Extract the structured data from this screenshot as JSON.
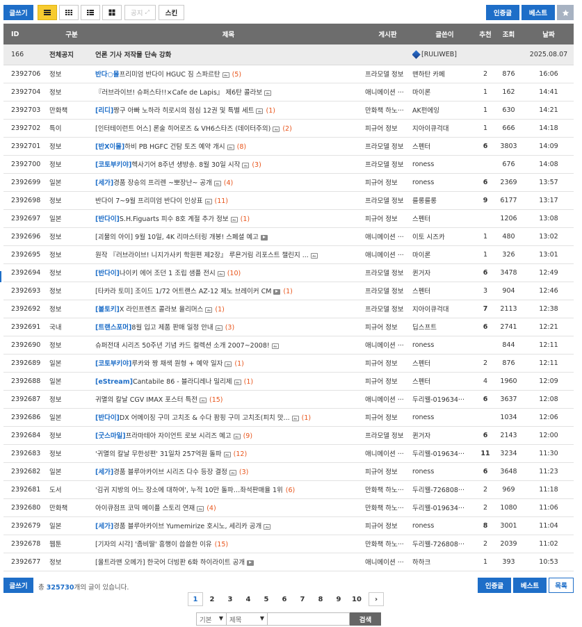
{
  "toolbar": {
    "write": "글쓰기",
    "notice": "공지",
    "skin": "스킨",
    "certified": "인증글",
    "best": "베스트"
  },
  "columns": {
    "id": "ID",
    "category": "구분",
    "title": "제목",
    "board": "게시판",
    "author": "글쓴이",
    "recommend": "추천",
    "views": "조회",
    "date": "날짜"
  },
  "notice_row": {
    "id": "166",
    "category": "전체공지",
    "title": "언론 기사 저작물 단속 강화",
    "author": "[RULIWEB]",
    "date": "2025.08.07"
  },
  "rows": [
    {
      "id": "2392706",
      "category": "정보",
      "tag": "반다○몰",
      "title": "프리미엄 반다이 HGUC 짐 스파르탄",
      "icon": "image",
      "comments": "(5)",
      "board": "프라모델 정보",
      "author": "맨하탄 카페",
      "recommend": "2",
      "rec_hot": false,
      "views": "876",
      "date": "16:06"
    },
    {
      "id": "2392704",
      "category": "정보",
      "tag": "",
      "title": "『러브라이브! 슈퍼스타!!×Cafe de Lapis』 제6탄 콜라보",
      "icon": "image",
      "comments": "",
      "board": "애니메이션 ···",
      "author": "마이론",
      "recommend": "1",
      "rec_hot": false,
      "views": "162",
      "date": "14:41"
    },
    {
      "id": "2392703",
      "category": "만화책",
      "tag": "[리디]",
      "title": "짱구 아빠 노하라 히로시의 점심 12권 및 특별 세트",
      "icon": "image",
      "comments": "(1)",
      "board": "만화책 하노···",
      "author": "AK펀에잉",
      "recommend": "1",
      "rec_hot": false,
      "views": "630",
      "date": "14:21"
    },
    {
      "id": "2392702",
      "category": "특이",
      "tag": "",
      "title": "[인터테이런트 어스] 론술 히어로즈 & VH6스타즈 (데이터주의)",
      "icon": "image",
      "comments": "(2)",
      "board": "피규어 정보",
      "author": "지아이큐걱대",
      "recommend": "1",
      "rec_hot": false,
      "views": "666",
      "date": "14:18"
    },
    {
      "id": "2392701",
      "category": "정보",
      "tag": "[반X이몰]",
      "title": "하비 PB HGFC 건탐 토즈 예약 개시",
      "icon": "image",
      "comments": "(8)",
      "board": "프라모델 정보",
      "author": "스펜터",
      "recommend": "6",
      "rec_hot": true,
      "views": "3803",
      "date": "14:09"
    },
    {
      "id": "2392700",
      "category": "정보",
      "tag": "[코토부키야]",
      "title": "헥사기어 8주년 생방송. 8월 30일 시작",
      "icon": "image",
      "comments": "(3)",
      "board": "프라모델 정보",
      "author": "roness",
      "recommend": "",
      "rec_hot": false,
      "views": "676",
      "date": "14:08"
    },
    {
      "id": "2392699",
      "category": "일본",
      "tag": "[세가]",
      "title": "경품 장승의 프리렌 ~뽀장난~ 공개",
      "icon": "image",
      "comments": "(4)",
      "board": "피규어 정보",
      "author": "roness",
      "recommend": "6",
      "rec_hot": true,
      "views": "2369",
      "date": "13:57"
    },
    {
      "id": "2392698",
      "category": "정보",
      "tag": "",
      "title": "반다이 7~9월 프리미엄 반다이 인상표",
      "icon": "image",
      "comments": "(11)",
      "board": "프라모델 정보",
      "author": "를롱를롱",
      "recommend": "9",
      "rec_hot": true,
      "views": "6177",
      "date": "13:17"
    },
    {
      "id": "2392697",
      "category": "일본",
      "tag": "[반다이]",
      "title": "S.H.Figuarts 피수 8호 계절 추가 정보",
      "icon": "image",
      "comments": "(1)",
      "board": "피규어 정보",
      "author": "스펜터",
      "recommend": "",
      "rec_hot": false,
      "views": "1206",
      "date": "13:08"
    },
    {
      "id": "2392696",
      "category": "정보",
      "tag": "",
      "title": "[괴물의 아이] 9월 10일, 4K 리마스터링 개봉! 스페셜 예고",
      "icon": "video",
      "comments": "",
      "board": "애니메이션 ···",
      "author": "이토 시즈카",
      "recommend": "1",
      "rec_hot": false,
      "views": "480",
      "date": "13:02"
    },
    {
      "id": "2392695",
      "category": "정보",
      "tag": "",
      "title": "원작 『러브라이브! 니지가사키 학원편 제2장』 루욘거림 리포스트 챌린지 ...",
      "icon": "image",
      "comments": "",
      "board": "애니메이션 ···",
      "author": "마이론",
      "recommend": "1",
      "rec_hot": false,
      "views": "326",
      "date": "13:01"
    },
    {
      "id": "2392694",
      "category": "정보",
      "tag": "[반다이]",
      "title": "나이키 에어 조던 1 조립 샘플 전시",
      "icon": "image",
      "comments": "(10)",
      "board": "프라모델 정보",
      "author": "퀸거자",
      "recommend": "6",
      "rec_hot": true,
      "views": "3478",
      "date": "12:49"
    },
    {
      "id": "2392693",
      "category": "정보",
      "tag": "",
      "title": "[타카라 토미] 조이드 1/72 어트랜스 AZ-12 제노 브레이커 CM",
      "icon": "video",
      "comments": "(1)",
      "board": "프라모델 정보",
      "author": "스펜터",
      "recommend": "3",
      "rec_hot": false,
      "views": "904",
      "date": "12:46"
    },
    {
      "id": "2392692",
      "category": "정보",
      "tag": "[볼토키]",
      "title": "X 라인프렌즈 콜라보 율리머스",
      "icon": "image",
      "comments": "(1)",
      "board": "프라모델 정보",
      "author": "지아이큐걱대",
      "recommend": "7",
      "rec_hot": true,
      "views": "2113",
      "date": "12:38"
    },
    {
      "id": "2392691",
      "category": "국내",
      "tag": "[트랜스포머]",
      "title": "8월 입고 제품 판매 일정 안내",
      "icon": "image",
      "comments": "(3)",
      "board": "피규어 정보",
      "author": "딥스프트",
      "recommend": "6",
      "rec_hot": true,
      "views": "2741",
      "date": "12:21"
    },
    {
      "id": "2392690",
      "category": "정보",
      "tag": "",
      "title": "슈퍼전대 시리즈 50주년 기념 카드 컬렉션 소개 2007~2008!",
      "icon": "image",
      "comments": "",
      "board": "애니메이션 ···",
      "author": "roness",
      "recommend": "",
      "rec_hot": false,
      "views": "844",
      "date": "12:11"
    },
    {
      "id": "2392689",
      "category": "일본",
      "tag": "[코토부키야]",
      "title": "루카와 짱 채색 원형 + 예약 일자",
      "icon": "image",
      "comments": "(1)",
      "board": "피규어 정보",
      "author": "스펜터",
      "recommend": "2",
      "rec_hot": false,
      "views": "876",
      "date": "12:11"
    },
    {
      "id": "2392688",
      "category": "일본",
      "tag": "[eStream]",
      "title": "Cantabile 86 - 블라디레나 밀리제",
      "icon": "image",
      "comments": "(1)",
      "board": "피규어 정보",
      "author": "스펜터",
      "recommend": "4",
      "rec_hot": false,
      "views": "1960",
      "date": "12:09"
    },
    {
      "id": "2392687",
      "category": "정보",
      "tag": "",
      "title": "귀멸의 칼날 CGV IMAX 포스터 특전",
      "icon": "image",
      "comments": "(15)",
      "board": "애니메이션 ···",
      "author": "두리웰-019634···",
      "recommend": "6",
      "rec_hot": true,
      "views": "3637",
      "date": "12:08"
    },
    {
      "id": "2392686",
      "category": "일본",
      "tag": "[반다이]",
      "title": "DX 어메이징 구미 고치조 & 수다 팜핑 구미 고치조(피치 맛...",
      "icon": "image",
      "comments": "(1)",
      "board": "피규어 정보",
      "author": "roness",
      "recommend": "",
      "rec_hot": false,
      "views": "1034",
      "date": "12:06"
    },
    {
      "id": "2392684",
      "category": "정보",
      "tag": "[굿스마일]",
      "title": "프라마테아 자이언트 로보 시리즈 예고",
      "icon": "image",
      "comments": "(9)",
      "board": "프라모델 정보",
      "author": "퀸거자",
      "recommend": "6",
      "rec_hot": true,
      "views": "2143",
      "date": "12:00"
    },
    {
      "id": "2392683",
      "category": "정보",
      "tag": "",
      "title": "'귀멸의 칼날 무한성편' 31일차 257억원 돌파",
      "icon": "image",
      "comments": "(12)",
      "board": "애니메이션 ···",
      "author": "두리웰-019634···",
      "recommend": "11",
      "rec_hot": true,
      "views": "3234",
      "date": "11:30"
    },
    {
      "id": "2392682",
      "category": "일본",
      "tag": "[세가]",
      "title": "경품 블루아카이브 시리즈 다수 등장 결정",
      "icon": "image",
      "comments": "(3)",
      "board": "피규어 정보",
      "author": "roness",
      "recommend": "6",
      "rec_hot": true,
      "views": "3648",
      "date": "11:23"
    },
    {
      "id": "2392681",
      "category": "도서",
      "tag": "",
      "title": "'김귀 지방의 어느 장소에 대하여', 누적 10만 돌파…좌석판매율 1위",
      "icon": "",
      "comments": "(6)",
      "board": "만화책 하노···",
      "author": "두리웰-726808···",
      "recommend": "2",
      "rec_hot": false,
      "views": "969",
      "date": "11:18"
    },
    {
      "id": "2392680",
      "category": "만화책",
      "tag": "",
      "title": "아이큐점프 코믹 메이플 스토리 연재",
      "icon": "image",
      "comments": "(4)",
      "board": "만화책 하노···",
      "author": "두리웰-019634···",
      "recommend": "2",
      "rec_hot": false,
      "views": "1080",
      "date": "11:06"
    },
    {
      "id": "2392679",
      "category": "일본",
      "tag": "[세가]",
      "title": "경품 블루아카이브 Yumemirize 호시노, 세리카 공개",
      "icon": "image",
      "comments": "",
      "board": "피규어 정보",
      "author": "roness",
      "recommend": "8",
      "rec_hot": true,
      "views": "3001",
      "date": "11:04"
    },
    {
      "id": "2392678",
      "category": "웹툰",
      "tag": "",
      "title": "[기자의 시각] '좀비딸' 흥행이 씁쓸한 이유",
      "icon": "",
      "comments": "(15)",
      "board": "만화책 하노···",
      "author": "두리웰-726808···",
      "recommend": "2",
      "rec_hot": false,
      "views": "2039",
      "date": "11:02"
    },
    {
      "id": "2392677",
      "category": "정보",
      "tag": "",
      "title": "[울트라맨 오메가] 한국어 더빙판 6화 하이라이트 공개",
      "icon": "video",
      "comments": "",
      "board": "애니메이션 ···",
      "author": "하하크",
      "recommend": "1",
      "rec_hot": false,
      "views": "393",
      "date": "10:53"
    }
  ],
  "bottom": {
    "write": "글쓰기",
    "total_prefix": "총",
    "total_count": "325730",
    "total_suffix": "개의 글이 있습니다.",
    "certified": "인증글",
    "best": "베스트",
    "list": "목록"
  },
  "pagination": {
    "pages": [
      "1",
      "2",
      "3",
      "4",
      "5",
      "6",
      "7",
      "8",
      "9",
      "10"
    ],
    "active": "1",
    "next": "›"
  },
  "search": {
    "scope": "기본",
    "field": "제목",
    "query": "",
    "button": "검색"
  },
  "colors": {
    "accent": "#1e6ec8",
    "header": "#6d6d6d",
    "hot": "#e8474f",
    "comment": "#e8541a",
    "yellow": "#f7cb2f"
  }
}
